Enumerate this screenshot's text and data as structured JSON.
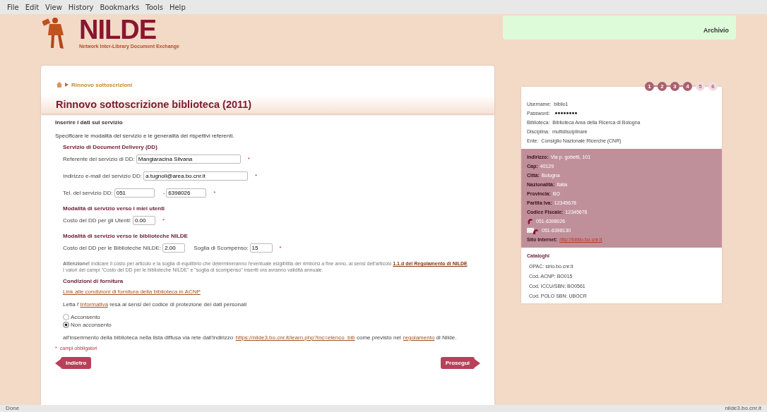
{
  "menu": [
    "File",
    "Edit",
    "View",
    "History",
    "Bookmarks",
    "Tools",
    "Help"
  ],
  "logo": {
    "title": "NILDE",
    "subtitle": "Network Inter-Library Document Exchange"
  },
  "archive_link": "Archivio",
  "breadcrumb": "Rinnovo sottoscrizioni",
  "page_title": "Rinnovo sottoscrizione biblioteca (2011)",
  "section_title": "Inserire i dati sul servizio",
  "intro": "Specificare le modalità del servizio e le generalità dei rispettivi referenti.",
  "groups": [
    {
      "title": "Servizio di Document Delivery (DD)",
      "rows": [
        {
          "fields": [
            {
              "label": "Referente del servizio di DD:",
              "value": "Mangiaracina Silvana"
            }
          ]
        },
        {
          "fields": [
            {
              "label": "Indirizzo e-mail del servizio DD:",
              "value": "a.tugnoli@area.bo.cnr.it"
            }
          ]
        },
        {
          "fields": [
            {
              "label": "Tel. del servizio DD:",
              "value": "051"
            },
            {
              "label": "-",
              "value": "6398026"
            }
          ]
        }
      ]
    },
    {
      "title": "Modalità di servizio verso i miei utenti",
      "rows": [
        {
          "fields": [
            {
              "label": "Costo del DD per gli Utenti:",
              "value": "0.00"
            }
          ]
        }
      ]
    },
    {
      "title": "Modalità di servizio verso le biblioteche NILDE",
      "rows": [
        {
          "fields": [
            {
              "label": "Costo del DD per le Biblioteche NILDE:",
              "value": "2.00"
            },
            {
              "label": "Soglia di Scompenso:",
              "value": "15"
            }
          ]
        }
      ]
    }
  ],
  "required_mark": "*",
  "notice": {
    "text": "**Attenzione!** Indicare il costo per articolo e la soglia di equilibrio che determineranno l'eventuale esigibilità dei rimborsi a fine anno, ai sensi dell'articolo",
    "link": "1.1.d del Regolamento di NILDE",
    "line2": "I valori dei campi \"Costo del DD per le biblioteche NILDE\" e \"soglia di scompenso\" inseriti ora avranno validità annuale."
  },
  "conditions_title": "Condizioni di fornitura",
  "conditions_link": "Link alle condizioni di fornitura della biblioteca in ACNP",
  "privacy": [
    {
      "kind": "text",
      "text": "Letta l'"
    },
    {
      "kind": "link",
      "text": "Informativa"
    },
    {
      "kind": "text",
      "text": " resa ai sensi del codice di protezione dei dati personali"
    }
  ],
  "consent": [
    {
      "label": "Acconsento",
      "selected": false
    },
    {
      "label": "Non acconsento",
      "selected": true
    }
  ],
  "listing": [
    {
      "kind": "text",
      "text": "all'inserimento della biblioteca nella lista diffusa via rete dall'indirizzo "
    },
    {
      "kind": "link",
      "text": "https://nilde3.bo.cnr.it/learn.php?inc=elenco_bib"
    },
    {
      "kind": "text",
      "text": " come previsto nel "
    },
    {
      "kind": "link",
      "text": "regolamento"
    },
    {
      "kind": "text",
      "text": " di Nilde."
    }
  ],
  "required_note": "campi obbligatori",
  "back_button": "Indietro",
  "next_button": "Prosegui",
  "steps": [
    {
      "label": "1",
      "done": true
    },
    {
      "label": "2",
      "done": true
    },
    {
      "label": "3",
      "done": true
    },
    {
      "label": "4",
      "done": true
    },
    {
      "label": "5",
      "done": false
    },
    {
      "label": "6",
      "done": false
    }
  ],
  "account": [
    {
      "kind": "text",
      "label": "Username:",
      "value": "biblio1"
    },
    {
      "kind": "secret",
      "label": "Password:",
      "value": "••••••••"
    },
    {
      "kind": "text",
      "label": "Biblioteca:",
      "value": "Biblioteca Area della Ricerca di Bologna"
    },
    {
      "kind": "text",
      "label": "Disciplina:",
      "value": "multidisciplinare"
    },
    {
      "kind": "text",
      "label": "Ente:",
      "value": "Consiglio Nazionale Ricerche (CNR)"
    }
  ],
  "address": [
    {
      "kind": "field",
      "label": "Indirizzo:",
      "value": "Via p. gobetti, 101"
    },
    {
      "kind": "field",
      "label": "Cap:",
      "value": "40129"
    },
    {
      "kind": "field",
      "label": "Città:",
      "value": "Bologna"
    },
    {
      "kind": "field",
      "label": "Nazionalità:",
      "value": "Italia"
    },
    {
      "kind": "field",
      "label": "Provincia:",
      "value": "BO"
    },
    {
      "kind": "field",
      "label": "Partita Iva:",
      "value": "12345678"
    },
    {
      "kind": "field",
      "label": "Codice Fiscale:",
      "value": "12345678"
    },
    {
      "kind": "phone",
      "value": "051-6398026"
    },
    {
      "kind": "fax",
      "value": "051-6398130"
    },
    {
      "kind": "site",
      "label": "Sito Internet:",
      "value": "http://biblio.bo.cnr.it"
    }
  ],
  "catalogs_title": "Cataloghi",
  "catalogs": [
    "OPAC: sirio.bo.cnr.it",
    "Cod. ACNP: BO015",
    "Cod. ICCU/SBN: BO0561",
    "Cod. POLO SBN: UBOCR"
  ],
  "status_bar": {
    "left": "Done",
    "right": "nilde3.bo.cnr.it"
  }
}
